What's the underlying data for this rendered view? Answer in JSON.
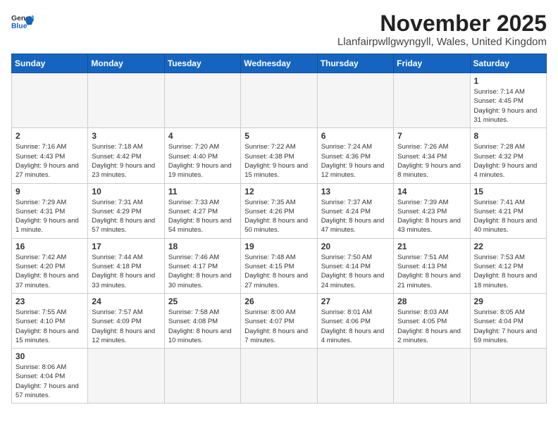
{
  "header": {
    "logo_general": "General",
    "logo_blue": "Blue",
    "month": "November 2025",
    "location": "Llanfairpwllgwyngyll, Wales, United Kingdom"
  },
  "days_of_week": [
    "Sunday",
    "Monday",
    "Tuesday",
    "Wednesday",
    "Thursday",
    "Friday",
    "Saturday"
  ],
  "weeks": [
    [
      {
        "day": "",
        "info": ""
      },
      {
        "day": "",
        "info": ""
      },
      {
        "day": "",
        "info": ""
      },
      {
        "day": "",
        "info": ""
      },
      {
        "day": "",
        "info": ""
      },
      {
        "day": "",
        "info": ""
      },
      {
        "day": "1",
        "info": "Sunrise: 7:14 AM\nSunset: 4:45 PM\nDaylight: 9 hours and 31 minutes."
      }
    ],
    [
      {
        "day": "2",
        "info": "Sunrise: 7:16 AM\nSunset: 4:43 PM\nDaylight: 9 hours and 27 minutes."
      },
      {
        "day": "3",
        "info": "Sunrise: 7:18 AM\nSunset: 4:42 PM\nDaylight: 9 hours and 23 minutes."
      },
      {
        "day": "4",
        "info": "Sunrise: 7:20 AM\nSunset: 4:40 PM\nDaylight: 9 hours and 19 minutes."
      },
      {
        "day": "5",
        "info": "Sunrise: 7:22 AM\nSunset: 4:38 PM\nDaylight: 9 hours and 15 minutes."
      },
      {
        "day": "6",
        "info": "Sunrise: 7:24 AM\nSunset: 4:36 PM\nDaylight: 9 hours and 12 minutes."
      },
      {
        "day": "7",
        "info": "Sunrise: 7:26 AM\nSunset: 4:34 PM\nDaylight: 9 hours and 8 minutes."
      },
      {
        "day": "8",
        "info": "Sunrise: 7:28 AM\nSunset: 4:32 PM\nDaylight: 9 hours and 4 minutes."
      }
    ],
    [
      {
        "day": "9",
        "info": "Sunrise: 7:29 AM\nSunset: 4:31 PM\nDaylight: 9 hours and 1 minute."
      },
      {
        "day": "10",
        "info": "Sunrise: 7:31 AM\nSunset: 4:29 PM\nDaylight: 8 hours and 57 minutes."
      },
      {
        "day": "11",
        "info": "Sunrise: 7:33 AM\nSunset: 4:27 PM\nDaylight: 8 hours and 54 minutes."
      },
      {
        "day": "12",
        "info": "Sunrise: 7:35 AM\nSunset: 4:26 PM\nDaylight: 8 hours and 50 minutes."
      },
      {
        "day": "13",
        "info": "Sunrise: 7:37 AM\nSunset: 4:24 PM\nDaylight: 8 hours and 47 minutes."
      },
      {
        "day": "14",
        "info": "Sunrise: 7:39 AM\nSunset: 4:23 PM\nDaylight: 8 hours and 43 minutes."
      },
      {
        "day": "15",
        "info": "Sunrise: 7:41 AM\nSunset: 4:21 PM\nDaylight: 8 hours and 40 minutes."
      }
    ],
    [
      {
        "day": "16",
        "info": "Sunrise: 7:42 AM\nSunset: 4:20 PM\nDaylight: 8 hours and 37 minutes."
      },
      {
        "day": "17",
        "info": "Sunrise: 7:44 AM\nSunset: 4:18 PM\nDaylight: 8 hours and 33 minutes."
      },
      {
        "day": "18",
        "info": "Sunrise: 7:46 AM\nSunset: 4:17 PM\nDaylight: 8 hours and 30 minutes."
      },
      {
        "day": "19",
        "info": "Sunrise: 7:48 AM\nSunset: 4:15 PM\nDaylight: 8 hours and 27 minutes."
      },
      {
        "day": "20",
        "info": "Sunrise: 7:50 AM\nSunset: 4:14 PM\nDaylight: 8 hours and 24 minutes."
      },
      {
        "day": "21",
        "info": "Sunrise: 7:51 AM\nSunset: 4:13 PM\nDaylight: 8 hours and 21 minutes."
      },
      {
        "day": "22",
        "info": "Sunrise: 7:53 AM\nSunset: 4:12 PM\nDaylight: 8 hours and 18 minutes."
      }
    ],
    [
      {
        "day": "23",
        "info": "Sunrise: 7:55 AM\nSunset: 4:10 PM\nDaylight: 8 hours and 15 minutes."
      },
      {
        "day": "24",
        "info": "Sunrise: 7:57 AM\nSunset: 4:09 PM\nDaylight: 8 hours and 12 minutes."
      },
      {
        "day": "25",
        "info": "Sunrise: 7:58 AM\nSunset: 4:08 PM\nDaylight: 8 hours and 10 minutes."
      },
      {
        "day": "26",
        "info": "Sunrise: 8:00 AM\nSunset: 4:07 PM\nDaylight: 8 hours and 7 minutes."
      },
      {
        "day": "27",
        "info": "Sunrise: 8:01 AM\nSunset: 4:06 PM\nDaylight: 8 hours and 4 minutes."
      },
      {
        "day": "28",
        "info": "Sunrise: 8:03 AM\nSunset: 4:05 PM\nDaylight: 8 hours and 2 minutes."
      },
      {
        "day": "29",
        "info": "Sunrise: 8:05 AM\nSunset: 4:04 PM\nDaylight: 7 hours and 59 minutes."
      }
    ],
    [
      {
        "day": "30",
        "info": "Sunrise: 8:06 AM\nSunset: 4:04 PM\nDaylight: 7 hours and 57 minutes."
      },
      {
        "day": "",
        "info": ""
      },
      {
        "day": "",
        "info": ""
      },
      {
        "day": "",
        "info": ""
      },
      {
        "day": "",
        "info": ""
      },
      {
        "day": "",
        "info": ""
      },
      {
        "day": "",
        "info": ""
      }
    ]
  ]
}
